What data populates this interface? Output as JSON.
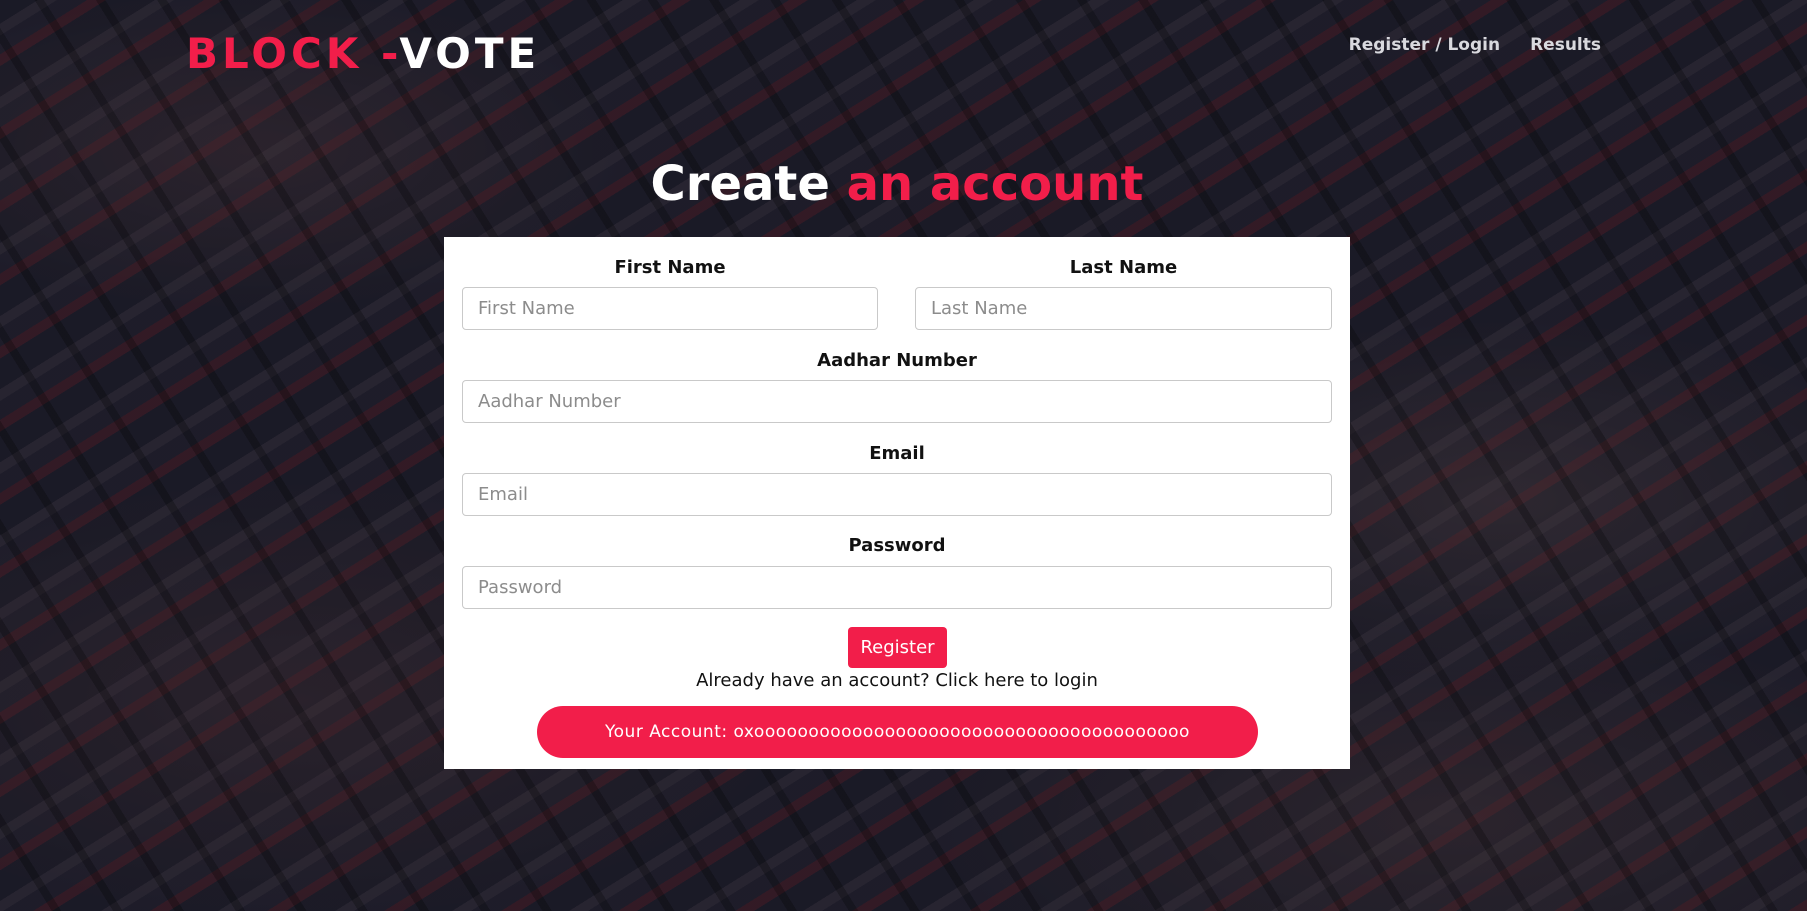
{
  "navbar": {
    "brand_part1": "BLOCK -",
    "brand_part2": "VOTE",
    "links": [
      {
        "label": "Register / Login"
      },
      {
        "label": "Results"
      }
    ]
  },
  "heading": {
    "part1": "Create ",
    "part2": "an account"
  },
  "form": {
    "first_name": {
      "label": "First Name",
      "placeholder": "First Name",
      "value": ""
    },
    "last_name": {
      "label": "Last Name",
      "placeholder": "Last Name",
      "value": ""
    },
    "aadhar": {
      "label": "Aadhar Number",
      "placeholder": "Aadhar Number",
      "value": ""
    },
    "email": {
      "label": "Email",
      "placeholder": "Email",
      "value": ""
    },
    "password": {
      "label": "Password",
      "placeholder": "Password",
      "value": ""
    },
    "register_label": "Register",
    "login_prompt": "Already have an account? Click here to login",
    "account_text": "Your Account: oxoooooooooooooooooooooooooooooooooooooooo"
  },
  "colors": {
    "accent": "#f21e4a",
    "card": "#ffffff",
    "text": "#111111"
  }
}
